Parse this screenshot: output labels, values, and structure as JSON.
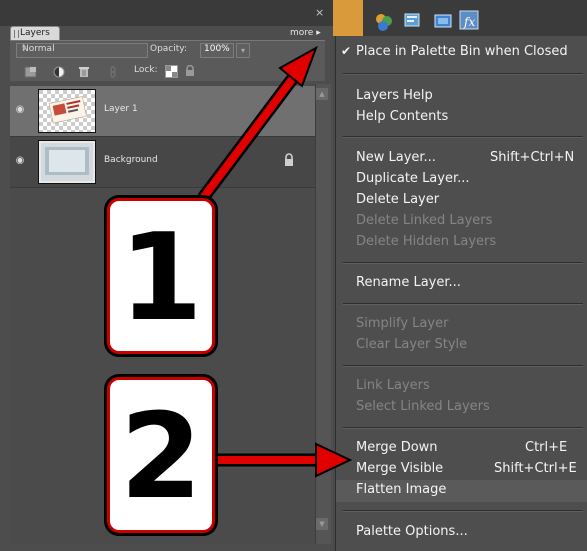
{
  "layers_panel": {
    "tab_label": "Layers",
    "more_label": "more",
    "close_icon": "×",
    "blend_mode": "Normal",
    "opacity_label": "Opacity:",
    "opacity_value": "100%",
    "lock_label": "Lock:",
    "layers": [
      {
        "name": "Layer 1",
        "selected": true,
        "locked": false
      },
      {
        "name": "Background",
        "selected": false,
        "locked": true
      }
    ]
  },
  "menu": {
    "place_in_bin": "Place in Palette Bin when Closed",
    "layers_help": "Layers Help",
    "help_contents": "Help Contents",
    "new_layer": "New Layer...",
    "new_layer_shortcut": "Shift+Ctrl+N",
    "duplicate_layer": "Duplicate Layer...",
    "delete_layer": "Delete Layer",
    "delete_linked": "Delete Linked Layers",
    "delete_hidden": "Delete Hidden Layers",
    "rename_layer": "Rename Layer...",
    "simplify_layer": "Simplify Layer",
    "clear_style": "Clear Layer Style",
    "link_layers": "Link Layers",
    "select_linked": "Select Linked Layers",
    "merge_down": "Merge Down",
    "merge_down_shortcut": "Ctrl+E",
    "merge_visible": "Merge Visible",
    "merge_visible_shortcut": "Shift+Ctrl+E",
    "flatten_image": "Flatten Image",
    "palette_options": "Palette Options..."
  },
  "callouts": {
    "one": "1",
    "two": "2"
  },
  "colors": {
    "arrow": "#e00000",
    "panel": "#4d4d4d",
    "menu": "#4e4e4e"
  }
}
